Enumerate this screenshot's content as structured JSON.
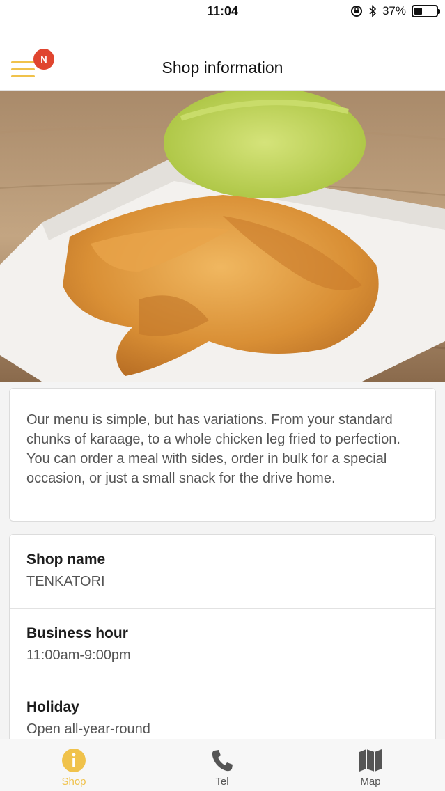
{
  "status_bar": {
    "time": "11:04",
    "battery_percent": "37%",
    "battery_level": 0.37
  },
  "header": {
    "title": "Shop information",
    "menu_badge": "N"
  },
  "description": "Our menu is simple, but has variations. From your standard chunks of karaage, to a whole chicken leg fried to perfection. You can order a meal with sides, order in bulk for a special occasion, or just a small snack for the drive home.",
  "info": [
    {
      "label": "Shop name",
      "value": "TENKATORI"
    },
    {
      "label": "Business hour",
      "value": "11:00am-9:00pm"
    },
    {
      "label": "Holiday",
      "value": "Open all-year-round"
    }
  ],
  "tabs": [
    {
      "label": "Shop",
      "icon": "info-icon",
      "active": true
    },
    {
      "label": "Tel",
      "icon": "phone-icon",
      "active": false
    },
    {
      "label": "Map",
      "icon": "map-icon",
      "active": false
    }
  ],
  "colors": {
    "accent": "#f0c24b",
    "badge": "#e0452f"
  }
}
